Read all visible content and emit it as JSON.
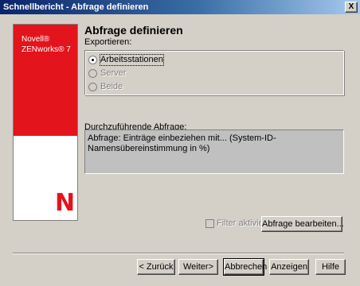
{
  "window": {
    "title": "Schnellbericht - Abfrage definieren",
    "close_glyph": "X"
  },
  "brand": {
    "line1": "Novell®",
    "line2": "ZENworks® 7",
    "mark": "N",
    "color": "#e3141c"
  },
  "page": {
    "heading": "Abfrage definieren",
    "export_label": "Exportieren:"
  },
  "export_options": [
    {
      "label": "Arbeitsstationen",
      "selected": true,
      "enabled": true
    },
    {
      "label": "Server",
      "selected": false,
      "enabled": false
    },
    {
      "label": "Beide",
      "selected": false,
      "enabled": false
    }
  ],
  "query": {
    "label": "Durchzuführende Abfrage:",
    "text": "Abfrage: Einträge einbeziehen mit... (System-ID-Namensübereinstimmung in %)"
  },
  "filter": {
    "label": "Filter aktivieren",
    "checked": false,
    "enabled": false
  },
  "buttons": {
    "edit_query": "Abfrage bearbeiten...",
    "back": "< Zurück",
    "next": "Weiter>",
    "cancel": "Abbrechen",
    "show": "Anzeigen",
    "help": "Hilfe"
  }
}
